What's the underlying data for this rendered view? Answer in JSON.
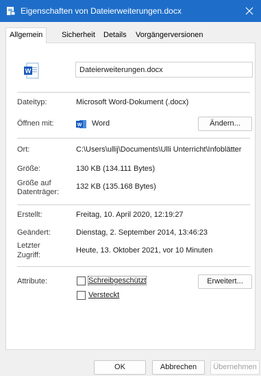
{
  "window": {
    "title": "Eigenschaften von Dateierweiterungen.docx"
  },
  "tabs": [
    {
      "label": "Allgemein"
    },
    {
      "label": "Sicherheit"
    },
    {
      "label": "Details"
    },
    {
      "label": "Vorgängerversionen"
    }
  ],
  "file": {
    "name": "Dateierweiterungen.docx"
  },
  "fields": {
    "dateityp": {
      "label": "Dateityp:",
      "value": "Microsoft Word-Dokument (.docx)"
    },
    "oeffnen": {
      "label": "Öffnen mit:",
      "value": "Word",
      "button": "Ändern..."
    },
    "ort": {
      "label": "Ort:",
      "value": "C:\\Users\\ullij\\Documents\\Ulli Unterricht\\Infoblätter"
    },
    "groesse": {
      "label": "Größe:",
      "value": "130 KB (134.111 Bytes)"
    },
    "groesse_datentraeger": {
      "label_line1": "Größe auf",
      "label_line2": "Datenträger:",
      "value": "132 KB (135.168 Bytes)"
    },
    "erstellt": {
      "label": "Erstellt:",
      "value": "Freitag, 10. April 2020, 12:19:27"
    },
    "geaendert": {
      "label": "Geändert:",
      "value": "Dienstag, 2. September 2014, 13:46:23"
    },
    "zugriff": {
      "label_line1": "Letzter",
      "label_line2": "Zugriff:",
      "value": "Heute, 13. Oktober 2021, vor 10 Minuten"
    },
    "attribute": {
      "label": "Attribute:",
      "readonly": {
        "label": "Schreibgeschützt",
        "checked": false
      },
      "hidden": {
        "label": "Versteckt",
        "checked": false
      },
      "advanced_button": "Erweitert..."
    }
  },
  "footer": {
    "ok": "OK",
    "cancel": "Abbrechen",
    "apply": "Übernehmen"
  },
  "colors": {
    "titlebar": "#1e6ec9",
    "word_blue": "#185abd"
  },
  "icons": {
    "app": "document-properties-icon",
    "file": "word-document-icon",
    "close": "close-icon",
    "word": "word-app-icon"
  }
}
